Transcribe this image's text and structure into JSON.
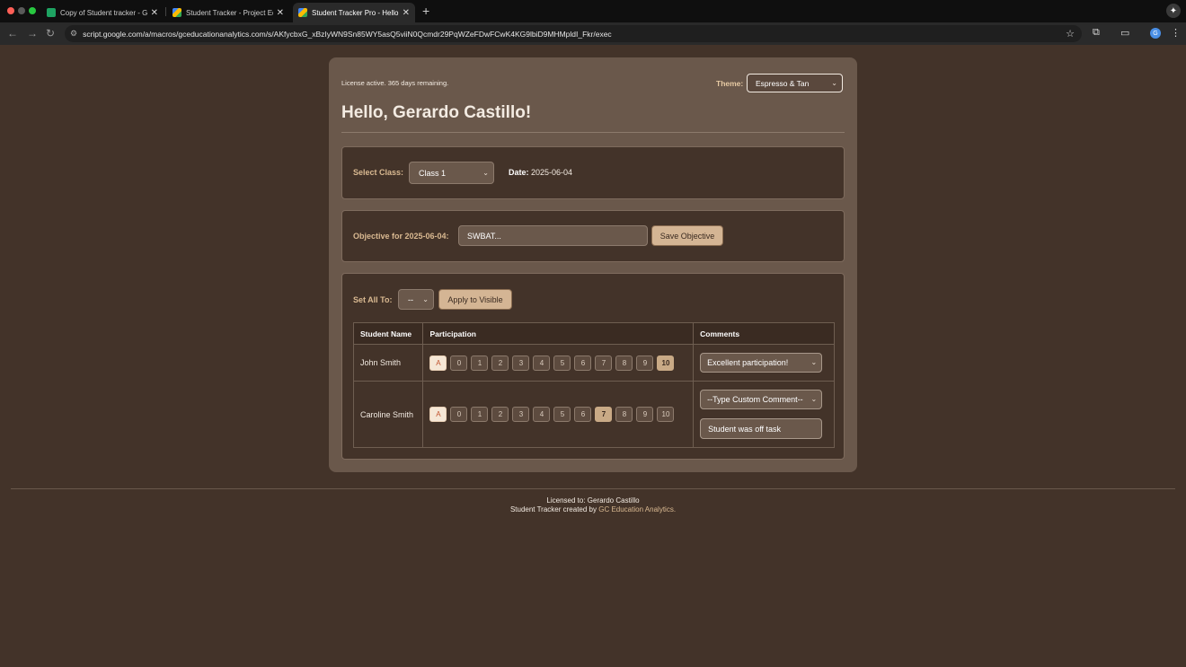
{
  "browser": {
    "tabs": [
      {
        "title": "Copy of Student tracker - Go",
        "icon": "sheets-icon",
        "active": false
      },
      {
        "title": "Student Tracker - Project Edi",
        "icon": "apps-script-icon",
        "active": false
      },
      {
        "title": "Student Tracker Pro - Hello, G",
        "icon": "apps-script-icon",
        "active": true
      }
    ],
    "url": "script.google.com/a/macros/gceducationanalytics.com/s/AKfycbxG_xBzIyWN9Sn85WY5asQ5viiN0Qcmdr29PqWZeFDwFCwK4KG9lbiD9MHMpldI_Fkr/exec",
    "profile_initial": "G",
    "new_tab_label": "+",
    "close_glyph": "✕"
  },
  "header": {
    "license_text": "License active. 365 days remaining.",
    "theme_label": "Theme:",
    "theme_value": "Espresso & Tan",
    "greeting": "Hello, Gerardo Castillo!"
  },
  "class_panel": {
    "select_label": "Select Class:",
    "class_value": "Class 1",
    "date_label": "Date:",
    "date_value": "2025-06-04"
  },
  "objective_panel": {
    "label": "Objective for 2025-06-04:",
    "input_value": "SWBAT...",
    "save_label": "Save Objective"
  },
  "participation_panel": {
    "set_all_label": "Set All To:",
    "set_all_value": "--",
    "apply_label": "Apply to Visible",
    "columns": [
      "Student Name",
      "Participation",
      "Comments"
    ],
    "score_options": [
      "A",
      "0",
      "1",
      "2",
      "3",
      "4",
      "5",
      "6",
      "7",
      "8",
      "9",
      "10"
    ],
    "students": [
      {
        "name": "John Smith",
        "selected": "10",
        "comment_select": "Excellent participation!",
        "custom_comment": ""
      },
      {
        "name": "Caroline Smith",
        "selected": "7",
        "comment_select": "--Type Custom Comment--",
        "custom_comment": "Student was off task"
      }
    ]
  },
  "footer": {
    "licensed_to": "Licensed to: Gerardo Castillo",
    "created_by_prefix": "Student Tracker created by ",
    "company_link": "GC Education Analytics.",
    "company_link_color": "#d9b991"
  },
  "colors": {
    "page_bg": "#433329",
    "card_bg": "#6a584b",
    "accent": "#d4b594"
  }
}
